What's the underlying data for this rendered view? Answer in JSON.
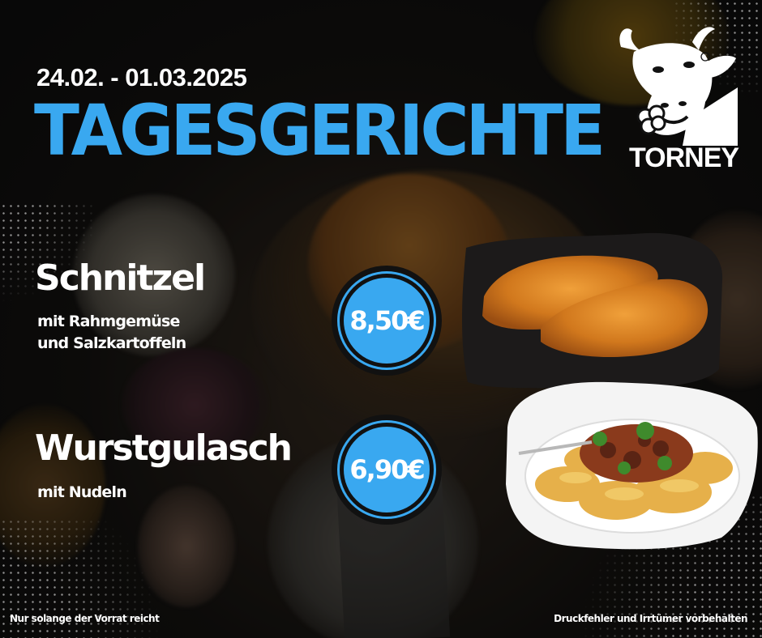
{
  "header": {
    "date_range": "24.02. - 01.03.2025",
    "title": "TAGESGERICHTE"
  },
  "brand": {
    "name": "TORNEY",
    "logo": "cow-head-logo"
  },
  "dishes": [
    {
      "name": "Schnitzel",
      "description_line1": "mit Rahmgemüse",
      "description_line2": "und Salzkartoffeln",
      "price": "8,50€",
      "image": "schnitzel-photo"
    },
    {
      "name": "Wurstgulasch",
      "description_line1": "mit Nudeln",
      "price": "6,90€",
      "image": "goulash-pasta-photo"
    }
  ],
  "footer": {
    "left_note": "Nur solange der Vorrat reicht",
    "right_note": "Druckfehler und Irrtümer vorbehalten"
  },
  "colors": {
    "accent": "#39a8f0",
    "background": "#141414",
    "text": "#ffffff"
  }
}
